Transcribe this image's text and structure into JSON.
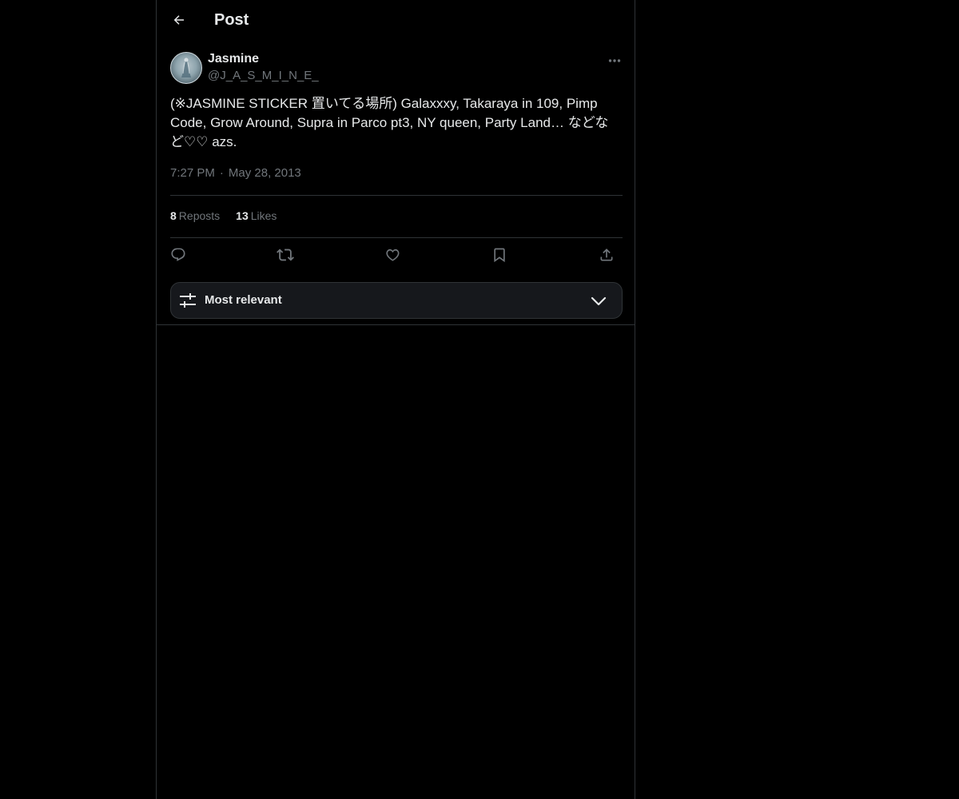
{
  "header": {
    "title": "Post",
    "back_icon": "arrow-left-icon"
  },
  "post": {
    "author_name": "Jasmine",
    "author_handle": "@J_A_S_M_I_N_E_",
    "text": "(※JASMINE STICKER 置いてる場所) Galaxxxy, Takaraya in 109, Pimp Code, Grow Around, Supra in Parco pt3, NY queen, Party Land… などなど♡♡ azs.",
    "time": "7:27 PM",
    "separator": "·",
    "date": "May 28, 2013",
    "reposts_count": "8",
    "reposts_label": "Reposts",
    "likes_count": "13",
    "likes_label": "Likes"
  },
  "actions": [
    "reply-icon",
    "repost-icon",
    "like-icon",
    "bookmark-icon",
    "share-icon"
  ],
  "sort": {
    "label": "Most relevant",
    "icon": "sliders-icon",
    "chevron": "chevron-down-icon"
  },
  "colors": {
    "background": "#000000",
    "text": "#e7e9ea",
    "muted": "#71767b",
    "border": "#2f3336",
    "panel": "#16181c"
  }
}
